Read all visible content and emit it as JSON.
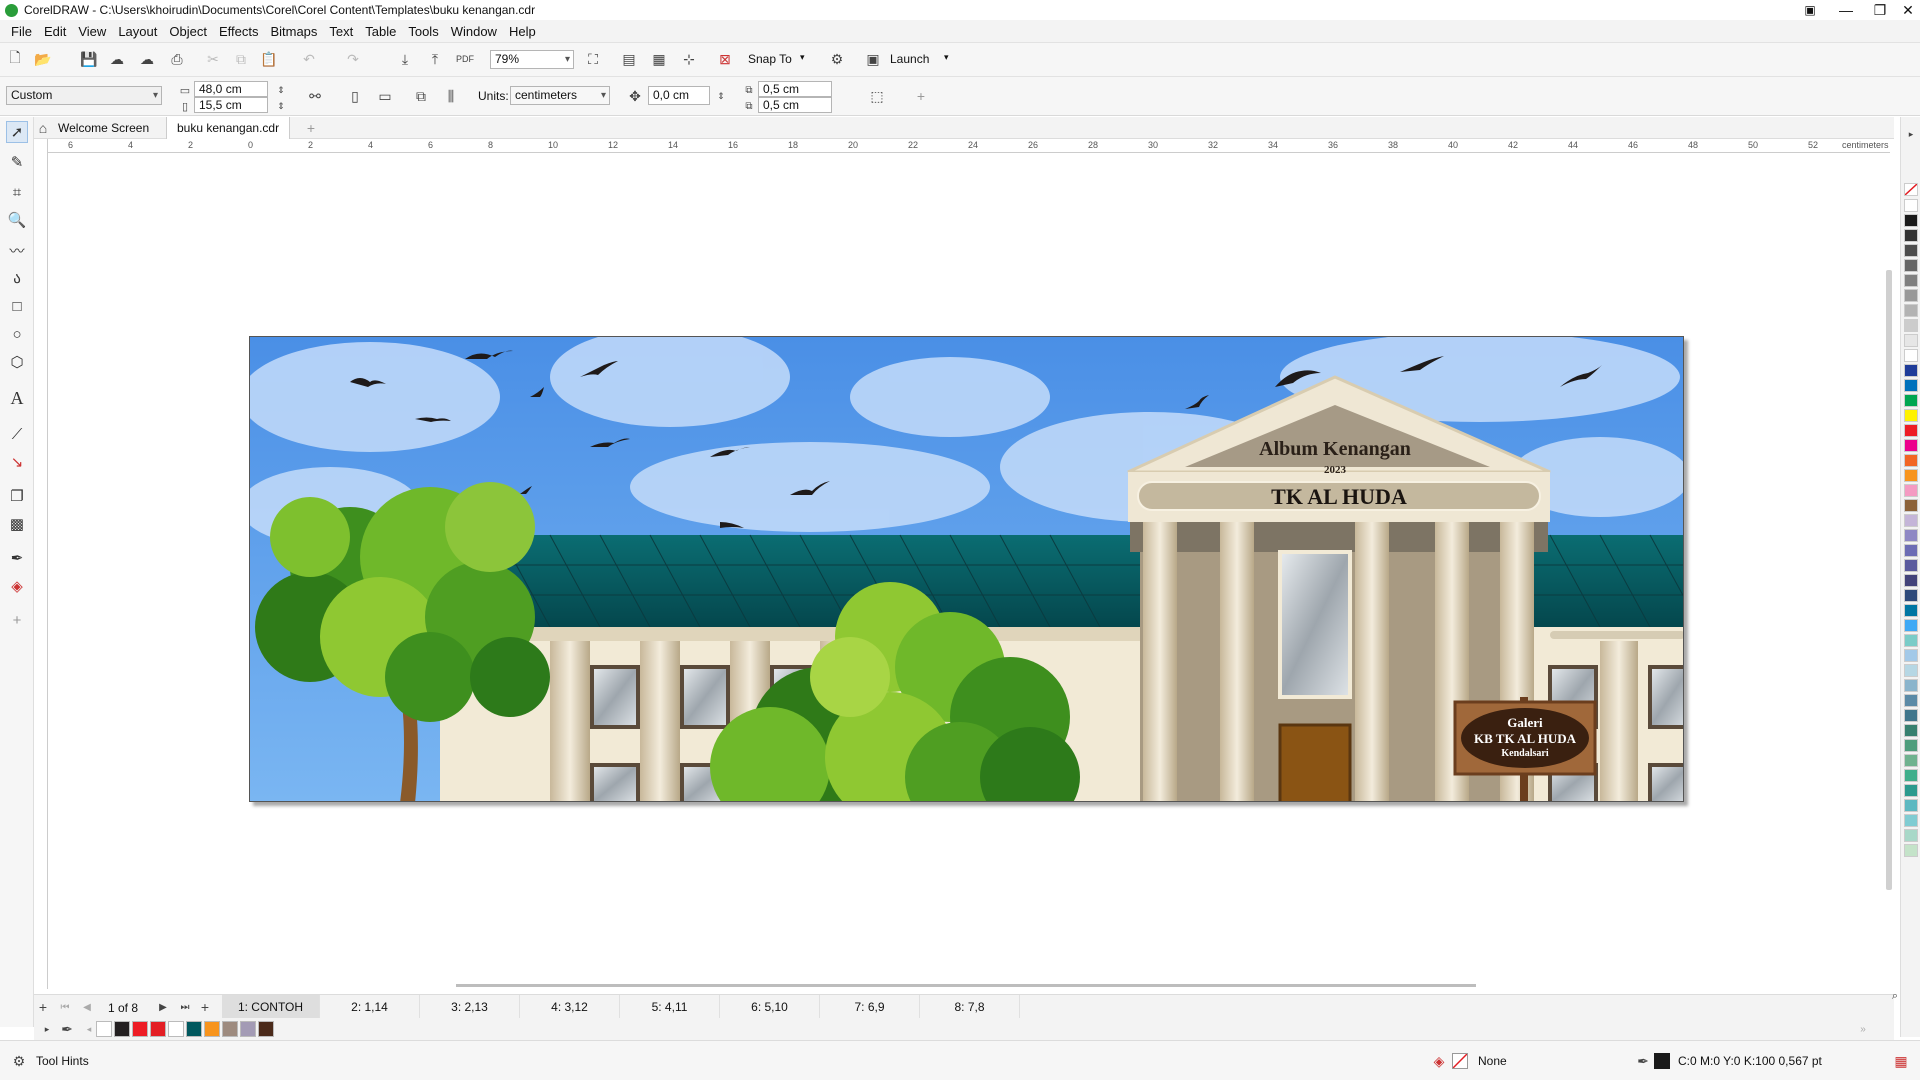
{
  "window": {
    "title": "CorelDRAW - C:\\Users\\khoirudin\\Documents\\Corel\\Corel Content\\Templates\\buku kenangan.cdr",
    "controls": [
      "—",
      "❐",
      "✕"
    ]
  },
  "menu": [
    "File",
    "Edit",
    "View",
    "Layout",
    "Object",
    "Effects",
    "Bitmaps",
    "Text",
    "Table",
    "Tools",
    "Window",
    "Help"
  ],
  "toolbar": {
    "zoom": "79%",
    "snap_label": "Snap To",
    "launch_label": "Launch"
  },
  "property_bar": {
    "preset": "Custom",
    "width": "48,0 cm",
    "height": "15,5 cm",
    "units_label": "Units:",
    "units": "centimeters",
    "nudge": "0,0 cm",
    "dup_x": "0,5 cm",
    "dup_y": "0,5 cm"
  },
  "doc_tabs": [
    "Welcome Screen",
    "buku kenangan.cdr"
  ],
  "ruler": {
    "unit": "centimeters",
    "ticks": [
      "6",
      "4",
      "2",
      "0",
      "2",
      "4",
      "6",
      "8",
      "10",
      "12",
      "14",
      "16",
      "18",
      "20",
      "22",
      "24",
      "26",
      "28",
      "30",
      "32",
      "34",
      "36",
      "38",
      "40",
      "42",
      "44",
      "46",
      "48",
      "50",
      "52"
    ]
  },
  "artwork": {
    "pediment_title": "Album Kenangan",
    "year": "2023",
    "banner": "TK AL HUDA",
    "sign": [
      "Galeri",
      "KB TK AL HUDA",
      "Kendalsari"
    ]
  },
  "pages": {
    "counter": "1 of 8",
    "tabs": [
      "1: CONTOH",
      "2: 1,14",
      "3: 2,13",
      "4: 3,12",
      "5: 4,11",
      "6: 5,10",
      "7: 6,9",
      "8: 7,8"
    ]
  },
  "doc_palette": [
    "#ffffff",
    "#231f20",
    "#ed1c24",
    "#e31e24",
    "#ffffff",
    "#00585e",
    "#f7941d",
    "#9e8b7f",
    "#a39bb5",
    "#4b2a1a"
  ],
  "color_palette": [
    "#ffffff",
    "#1a1a1a",
    "#333333",
    "#4d4d4d",
    "#666666",
    "#808080",
    "#999999",
    "#b3b3b3",
    "#cccccc",
    "#e6e6e6",
    "#ffffff",
    "#1f3c99",
    "#0072bc",
    "#00a651",
    "#fff200",
    "#ed1c24",
    "#ec008c",
    "#f26522",
    "#f7941d",
    "#f49ac2",
    "#8c6239",
    "#c4b5d8",
    "#8e87c4",
    "#6c6cb4",
    "#5a5a9e",
    "#43437a",
    "#2e4a7a",
    "#0076a3",
    "#3fa9f5",
    "#7accc8",
    "#a3c9e8",
    "#b6d7e4",
    "#8ab4cc",
    "#5b8aa6",
    "#40768c",
    "#37806f",
    "#4e9d7c",
    "#6fb28f",
    "#3fae8b",
    "#2b9a8e",
    "#5cb8c1",
    "#80ccd2",
    "#a8d8c8",
    "#c4e3c9"
  ],
  "status": {
    "tool_hints": "Tool Hints",
    "fill": "None",
    "outline": "C:0 M:0 Y:0 K:100  0,567 pt"
  }
}
